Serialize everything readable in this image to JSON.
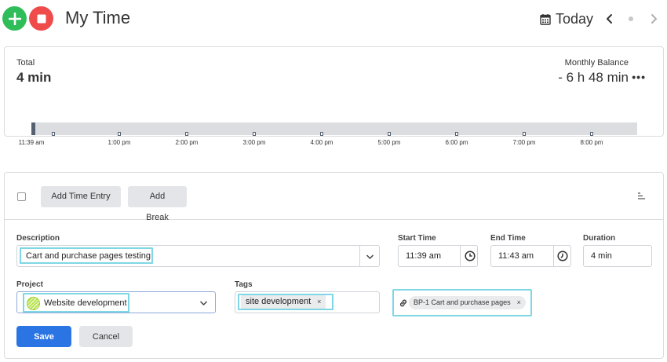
{
  "header": {
    "title": "My Time",
    "date_label": "Today"
  },
  "summary": {
    "total_label": "Total",
    "total_value": "4 min",
    "balance_label": "Monthly Balance",
    "balance_value": "- 6 h 48 min",
    "more_glyph": "•••"
  },
  "timeline": {
    "progress_fraction": 0.006,
    "start_label": "11:39 am",
    "hour_labels": [
      "1:00 pm",
      "2:00 pm",
      "3:00 pm",
      "4:00 pm",
      "5:00 pm",
      "6:00 pm",
      "7:00 pm",
      "8:00 pm"
    ]
  },
  "toolbar": {
    "add_entry_label": "Add Time Entry",
    "add_break_label": "Add Break"
  },
  "form": {
    "description_label": "Description",
    "description_value": "Cart and purchase pages testing",
    "start_label": "Start Time",
    "start_value": "11:39 am",
    "end_label": "End Time",
    "end_value": "11:43 am",
    "duration_label": "Duration",
    "duration_value": "4 min",
    "project_label": "Project",
    "project_value": "Website development",
    "tags_label": "Tags",
    "tag_value": "site development",
    "tag_remove": "×",
    "task_value": "BP-1 Cart and purchase pages",
    "task_remove": "×"
  },
  "actions": {
    "save_label": "Save",
    "cancel_label": "Cancel"
  },
  "colors": {
    "add_green": "#2ebd59",
    "stop_red": "#ef4b4b",
    "primary_blue": "#2b74e4",
    "highlight_cyan": "#7fd6e4"
  },
  "icons": [
    "plus-icon",
    "stop-icon",
    "calendar-icon",
    "chevron-left-icon",
    "chevron-right-icon",
    "more-icon",
    "sort-icon",
    "chevron-down-icon",
    "clock-icon",
    "link-icon",
    "close-icon"
  ]
}
